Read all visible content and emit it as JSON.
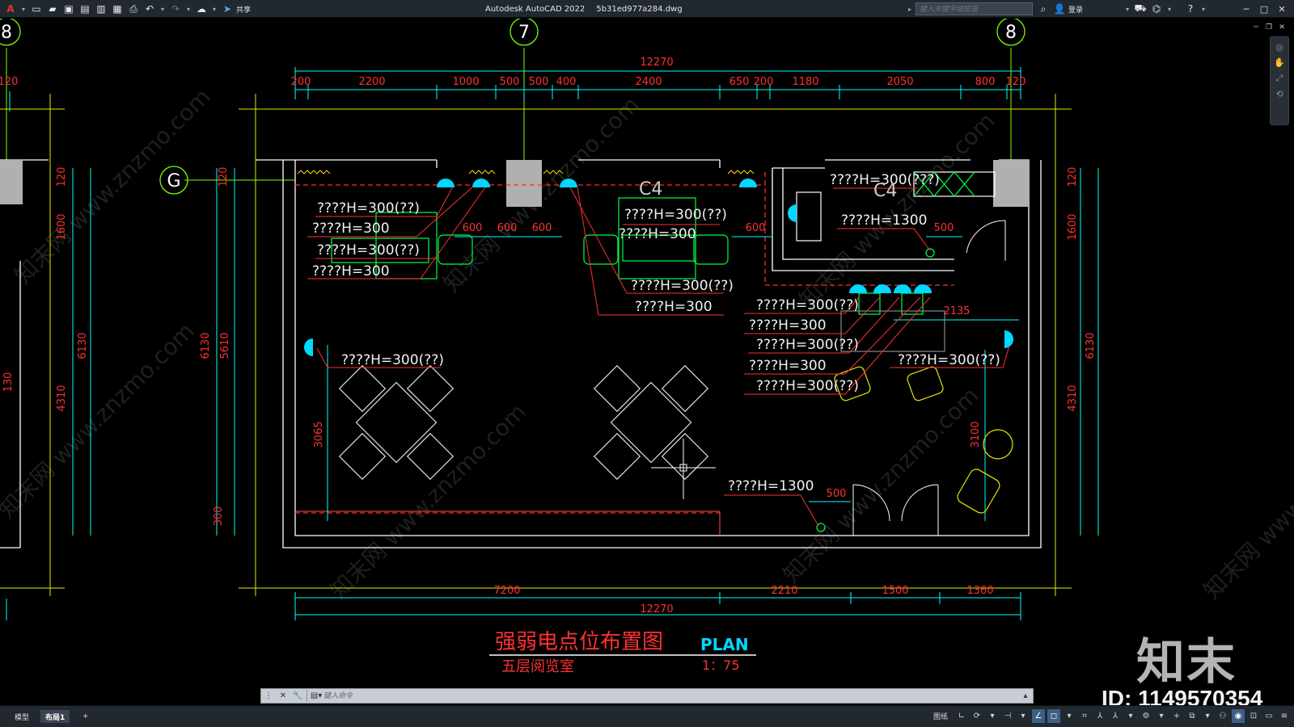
{
  "app": {
    "title": "Autodesk AutoCAD 2022",
    "filename": "5b31ed977a284.dwg",
    "share_label": "共享",
    "search_placeholder": "键入关键字或短语",
    "login_label": "登录"
  },
  "drawing": {
    "title_cn": "强弱电点位布置图",
    "title_en": "PLAN",
    "room": "五层阅览室",
    "scale": "1：75",
    "top_total": "12270",
    "top_dims": [
      "200",
      "2200",
      "1000",
      "500",
      "500",
      "400",
      "2400",
      "650",
      "200",
      "1180",
      "2050",
      "800",
      "120",
      "120"
    ],
    "bottom_dims": [
      "7200",
      "2210",
      "1500",
      "1360"
    ],
    "bottom_total": "12270",
    "left_dims_outer": [
      "120",
      "1600",
      "6130",
      "4310",
      "130"
    ],
    "left_dims_inner": [
      "120",
      "5610",
      "6130",
      "300"
    ],
    "right_dims": [
      "120",
      "1600",
      "6130",
      "4310"
    ],
    "inner_dims": [
      "600",
      "600",
      "600",
      "600",
      "500",
      "500",
      "3065",
      "3100",
      "2135"
    ],
    "grid_bubbles": [
      "8",
      "7",
      "8",
      "G"
    ],
    "labels": {
      "h300_2": "????H=300(??)",
      "h300": "????H=300",
      "h300_3": "????H=300(???)",
      "h1300": "????H=1300",
      "c4": "C4"
    },
    "watermark_text": "知末网 www.znzmo.com"
  },
  "brand": {
    "logo": "知末",
    "id": "ID: 1149570354"
  },
  "command": {
    "placeholder": "键入命令"
  },
  "status": {
    "tab_model": "模型",
    "tab_layout1": "布局1",
    "tab_add": "+",
    "paper_label": "图纸"
  },
  "colors": {
    "dim_cyan": "#00ffff",
    "text_red": "#ff3030",
    "wall_white": "#ffffff",
    "furniture_green": "#00ff44",
    "grid_green": "#7cff00",
    "bg": "#000000"
  }
}
